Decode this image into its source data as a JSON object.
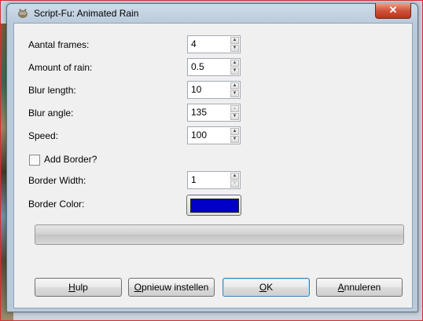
{
  "window": {
    "title": "Script-Fu: Animated Rain",
    "close_glyph": "✕"
  },
  "fields": [
    {
      "label": "Aantal frames:",
      "value": "4"
    },
    {
      "label": "Amount of rain:",
      "value": "0.5"
    },
    {
      "label": "Blur length:",
      "value": "10"
    },
    {
      "label": "Blur angle:",
      "value": "135"
    },
    {
      "label": "Speed:",
      "value": "100"
    }
  ],
  "add_border": {
    "label": "Add Border?",
    "checked": false
  },
  "border_width": {
    "label": "Border Width:",
    "value": "1"
  },
  "border_color": {
    "label": "Border Color:",
    "color": "#0000c8"
  },
  "progress": {
    "value": 0
  },
  "buttons": {
    "help": {
      "mnemonic": "H",
      "rest": "ulp"
    },
    "reset": {
      "mnemonic": "O",
      "rest": "pnieuw instellen"
    },
    "ok": {
      "mnemonic": "O",
      "rest": "K"
    },
    "cancel": {
      "mnemonic": "A",
      "rest": "nnuleren"
    }
  },
  "icons": {
    "title": "gimp-wilber-icon",
    "close": "close-icon",
    "spin_up": "spin-up-arrow-icon",
    "spin_down": "spin-down-arrow-icon"
  }
}
